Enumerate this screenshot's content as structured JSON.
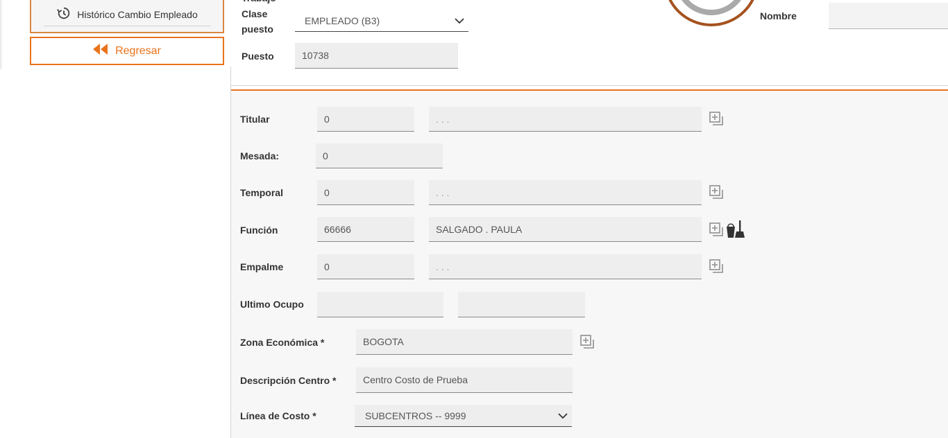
{
  "sidebar": {
    "history_button_label": "Histórico Cambio Empleado",
    "back_button_label": "Regresar"
  },
  "header": {
    "cut_label": "Trabajo",
    "clase_puesto_label_1": "Clase",
    "clase_puesto_label_2": "puesto",
    "clase_puesto_value": "EMPLEADO (B3)",
    "puesto_label": "Puesto",
    "puesto_value": "10738",
    "nombre_label": "Nombre",
    "nombre_value": ""
  },
  "form": {
    "titular": {
      "label": "Titular",
      "code": "0",
      "name": ". . ."
    },
    "mesada": {
      "label": "Mesada:",
      "value": "0"
    },
    "temporal": {
      "label": "Temporal",
      "code": "0",
      "name": ". . ."
    },
    "funcion": {
      "label": "Función",
      "code": "66666",
      "name": "SALGADO . PAULA"
    },
    "empalme": {
      "label": "Empalme",
      "code": "0",
      "name": ". . ."
    },
    "ultimo_ocupo": {
      "label": "Ultimo Ocupo",
      "value1": "",
      "value2": ""
    },
    "zona_economica": {
      "label": "Zona Económica *",
      "value": "BOGOTA"
    },
    "descripcion_centro": {
      "label": "Descripción Centro *",
      "value": "Centro Costo de Prueba"
    },
    "linea_costo": {
      "label": "Línea de Costo *",
      "value": "SUBCENTROS -- 9999"
    }
  },
  "colors": {
    "accent": "#e8731a",
    "border_brown": "#a5521f"
  },
  "icons": [
    "history-icon",
    "double-chevron-left-icon",
    "chevron-down-icon",
    "search-add-icon",
    "clean-icon"
  ]
}
